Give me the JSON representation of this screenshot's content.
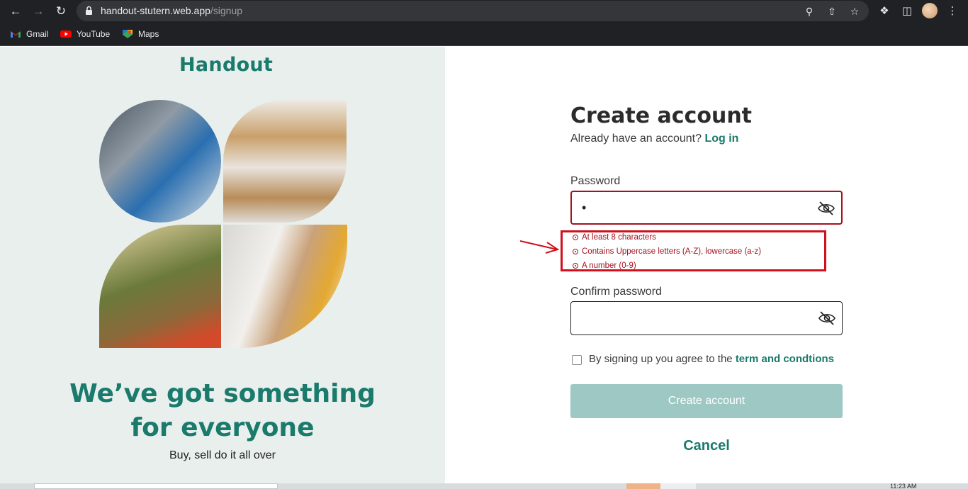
{
  "browser": {
    "url_host": "handout-stutern.web.app",
    "url_path": "/signup",
    "bookmarks": [
      {
        "label": "Gmail",
        "icon": "gmail-icon"
      },
      {
        "label": "YouTube",
        "icon": "youtube-icon"
      },
      {
        "label": "Maps",
        "icon": "maps-icon"
      }
    ]
  },
  "brand": {
    "logo": "Handout",
    "tagline_line1": "We’ve got something",
    "tagline_line2": "for everyone",
    "subtagline": "Buy, sell do it all over"
  },
  "form": {
    "title": "Create account",
    "have_account": "Already have an account?",
    "login_link": "Log in",
    "password_label": "Password",
    "password_value": "•",
    "hints": [
      "At least 8 characters",
      "Contains Uppercase letters (A-Z), lowercase (a-z)",
      "A number (0-9)"
    ],
    "confirm_label": "Confirm password",
    "confirm_value": "",
    "terms_prefix": "By signing up you agree to the",
    "terms_link": "term and condtions",
    "submit_label": "Create account",
    "cancel_label": "Cancel"
  },
  "taskbar": {
    "time": "11:23 AM"
  },
  "colors": {
    "brand_green": "#1a7a6c",
    "left_bg": "#e8efec",
    "error_red": "#a3121f",
    "button_disabled": "#9ec8c3"
  }
}
